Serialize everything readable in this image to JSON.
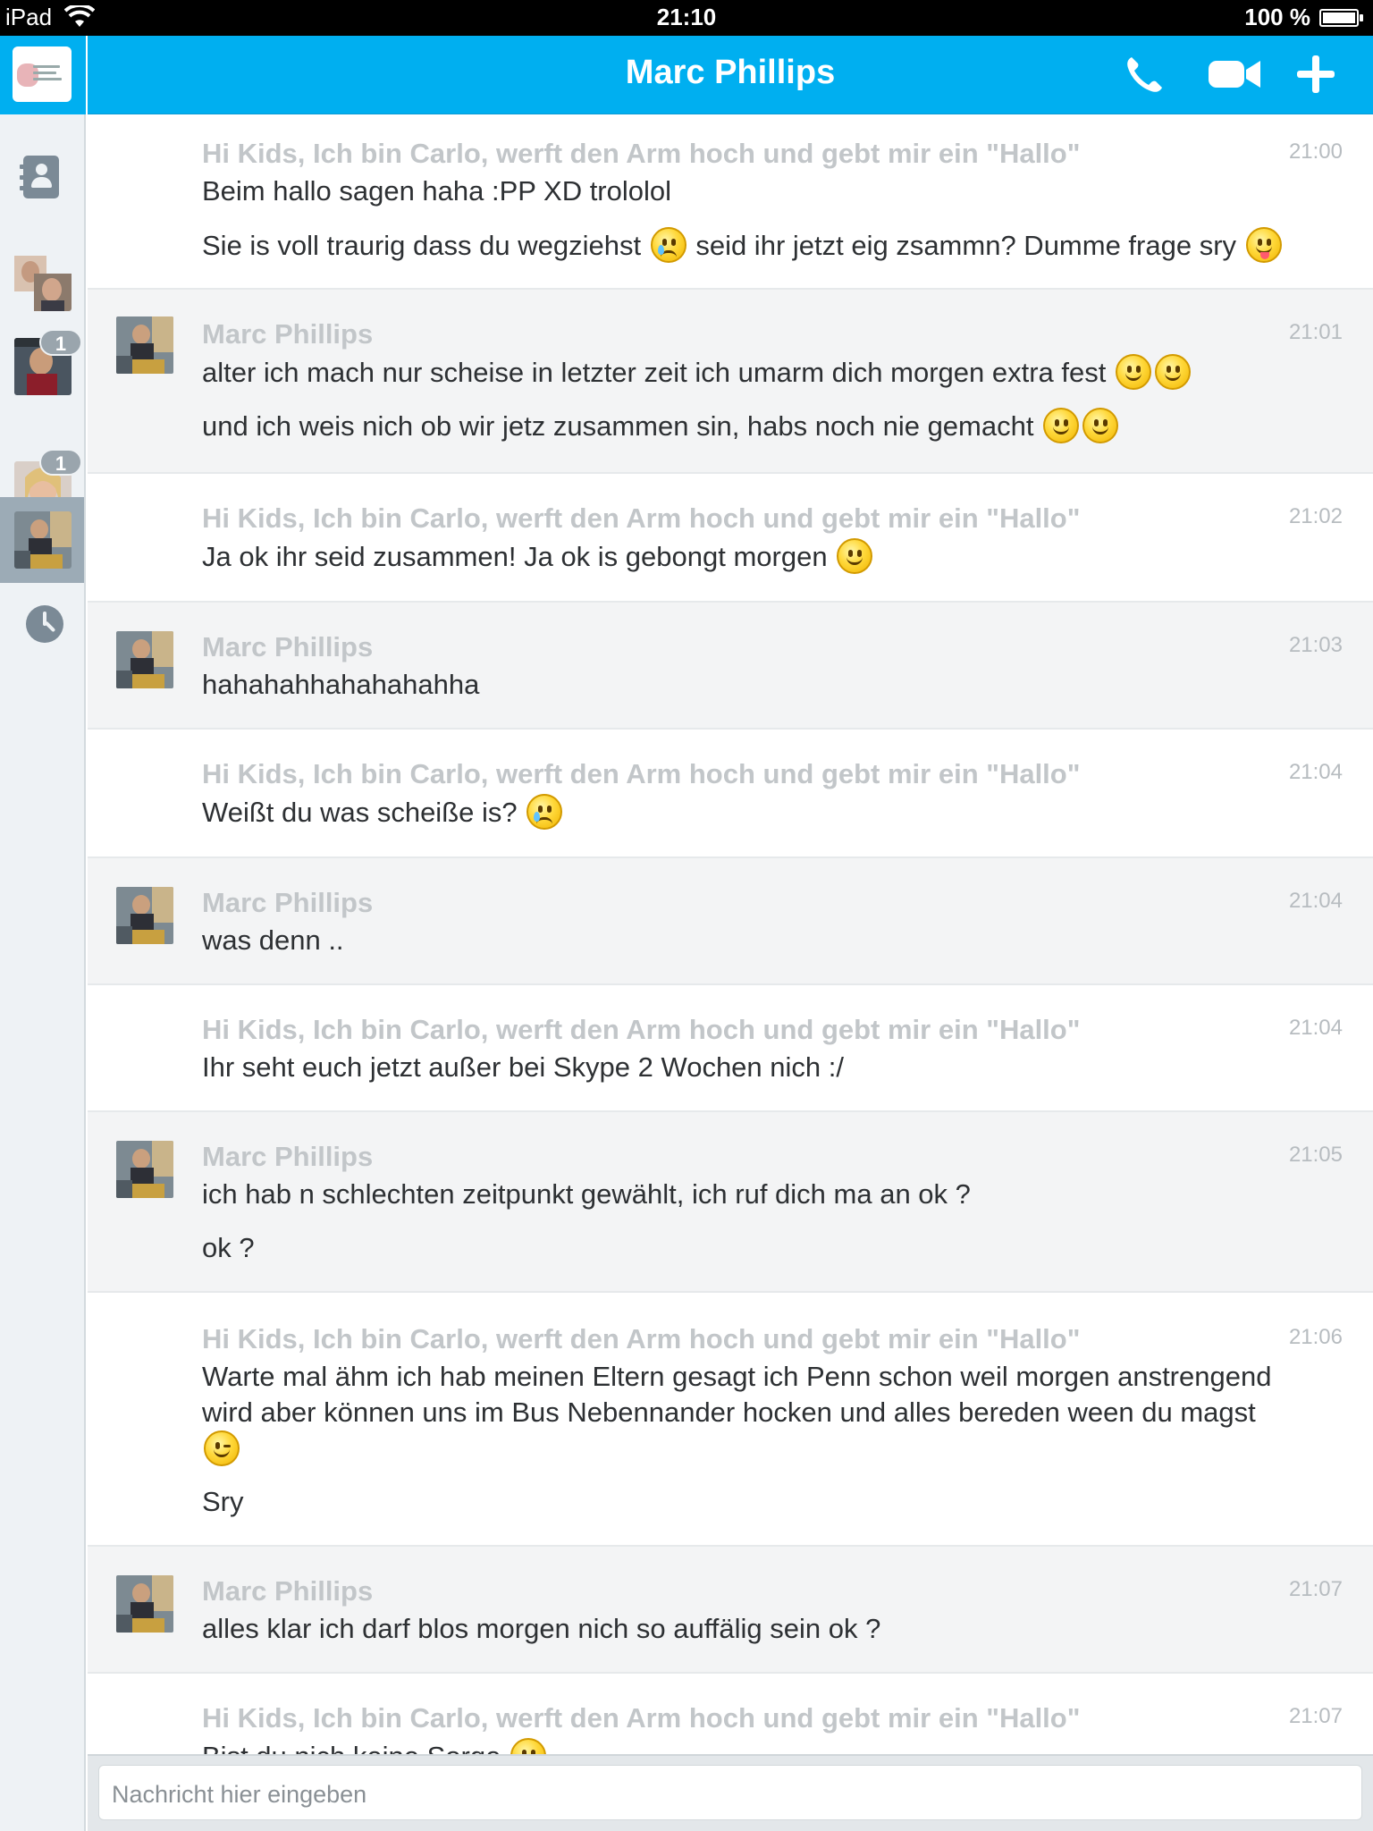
{
  "status_bar": {
    "carrier": "iPad",
    "time": "21:10",
    "battery": "100 %"
  },
  "sidebar": {
    "items": [
      {
        "name": "contacts",
        "icon": "contacts-icon"
      },
      {
        "name": "recent-chat-1",
        "badge": ""
      },
      {
        "name": "recent-chat-2",
        "badge": "1"
      },
      {
        "name": "recent-chat-3",
        "badge": "1"
      },
      {
        "name": "recent-chat-marc",
        "badge": "",
        "selected": true
      },
      {
        "name": "history",
        "icon": "clock-icon"
      }
    ]
  },
  "header": {
    "title": "Marc Phillips",
    "call_icon": "phone-icon",
    "video_icon": "video-icon",
    "add_icon": "plus-icon"
  },
  "messages": [
    {
      "sender": "Hi Kids, Ich bin Carlo, werft den Arm hoch und gebt mir ein \"Hallo\"",
      "time": "21:00",
      "lines": [
        "Beim hallo sagen haha :PP XD trololol",
        "Sie is voll traurig dass du wegziehst",
        "seid ihr jetzt eig zsammn? Dumme frage sry"
      ]
    },
    {
      "sender": "Marc Phillips",
      "time": "21:01",
      "lines": [
        "alter ich mach nur scheise in letzter zeit ich umarm dich morgen extra fest",
        "und ich weis nich ob wir jetz zusammen sin, habs noch nie gemacht"
      ]
    },
    {
      "sender": "Hi Kids, Ich bin Carlo, werft den Arm hoch und gebt mir ein \"Hallo\"",
      "time": "21:02",
      "lines": [
        "Ja ok ihr seid zusammen! Ja ok is gebongt morgen"
      ]
    },
    {
      "sender": "Marc Phillips",
      "time": "21:03",
      "lines": [
        "hahahahhahahahahha"
      ]
    },
    {
      "sender": "Hi Kids, Ich bin Carlo, werft den Arm hoch und gebt mir ein \"Hallo\"",
      "time": "21:04",
      "lines": [
        "Weißt du was scheiße is?"
      ]
    },
    {
      "sender": "Marc Phillips",
      "time": "21:04",
      "lines": [
        "was denn .."
      ]
    },
    {
      "sender": "Hi Kids, Ich bin Carlo, werft den Arm hoch und gebt mir ein \"Hallo\"",
      "time": "21:04",
      "lines": [
        "Ihr seht euch jetzt außer bei Skype 2 Wochen nich :/"
      ]
    },
    {
      "sender": "Marc Phillips",
      "time": "21:05",
      "lines": [
        "ich hab n schlechten zeitpunkt gewählt, ich ruf dich ma an ok ?",
        "ok ?"
      ]
    },
    {
      "sender": "Hi Kids, Ich bin Carlo, werft den Arm hoch und gebt mir ein \"Hallo\"",
      "time": "21:06",
      "lines": [
        "Warte mal ähm ich hab meinen Eltern gesagt ich Penn schon weil morgen anstrengend",
        "wird aber können uns im Bus Nebennander hocken und alles bereden ween du magst",
        "Sry"
      ]
    },
    {
      "sender": "Marc Phillips",
      "time": "21:07",
      "lines": [
        "alles klar ich darf blos morgen nich so auffälig sein ok ?"
      ]
    },
    {
      "sender": "Hi Kids, Ich bin Carlo, werft den Arm hoch und gebt mir ein \"Hallo\"",
      "time": "21:07",
      "lines": [
        "Bist du nich keine Sorge"
      ]
    }
  ],
  "input": {
    "placeholder": "Nachricht hier eingeben"
  },
  "colors": {
    "accent": "#00aff0",
    "sender_grey": "#c2c6c9",
    "row_grey": "#f3f4f5"
  }
}
